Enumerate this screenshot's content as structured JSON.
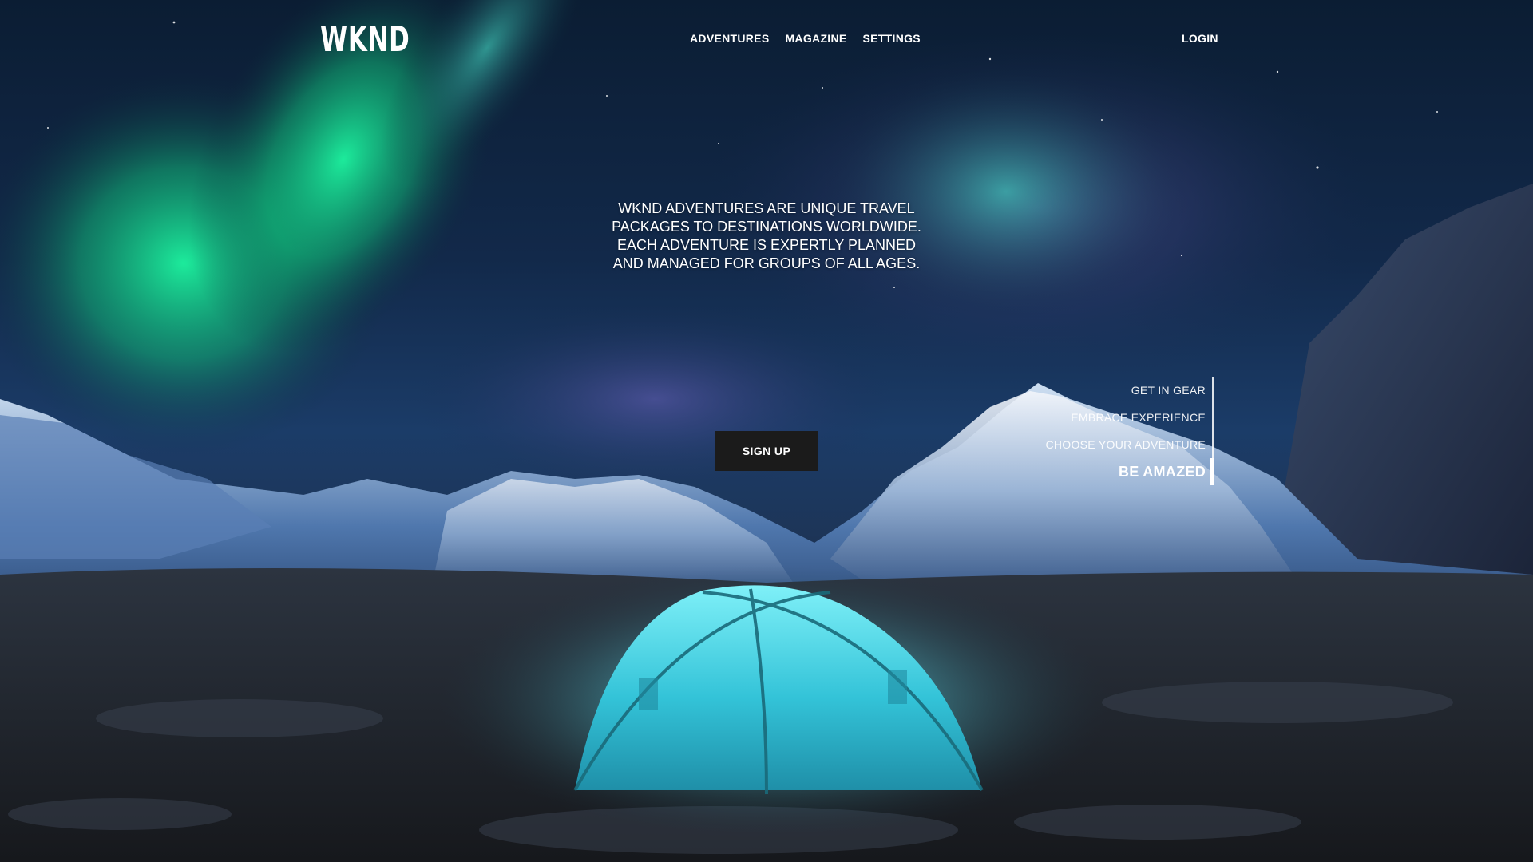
{
  "nav": {
    "logo": "WKND",
    "links": [
      {
        "label": "ADVENTURES"
      },
      {
        "label": "MAGAZINE"
      },
      {
        "label": "SETTINGS"
      }
    ],
    "login_label": "LOGIN"
  },
  "hero": {
    "tagline": "WKND ADVENTURES ARE UNIQUE TRAVEL PACKAGES TO DESTINATIONS WORLDWIDE. EACH ADVENTURE IS EXPERTLY PLANNED AND MANAGED FOR GROUPS OF ALL AGES.",
    "cta_label": "SIGN UP"
  },
  "carousel": {
    "items": [
      {
        "label": "GET IN GEAR",
        "active": false
      },
      {
        "label": "EMBRACE EXPERIENCE",
        "active": false
      },
      {
        "label": "CHOOSE YOUR ADVENTURE",
        "active": false
      },
      {
        "label": "BE AMAZED",
        "active": true
      }
    ]
  },
  "colors": {
    "text": "#ffffff",
    "button_bg": "#1b1b1b",
    "aurora": "#1de38a",
    "tent": "#3fd4e6"
  }
}
